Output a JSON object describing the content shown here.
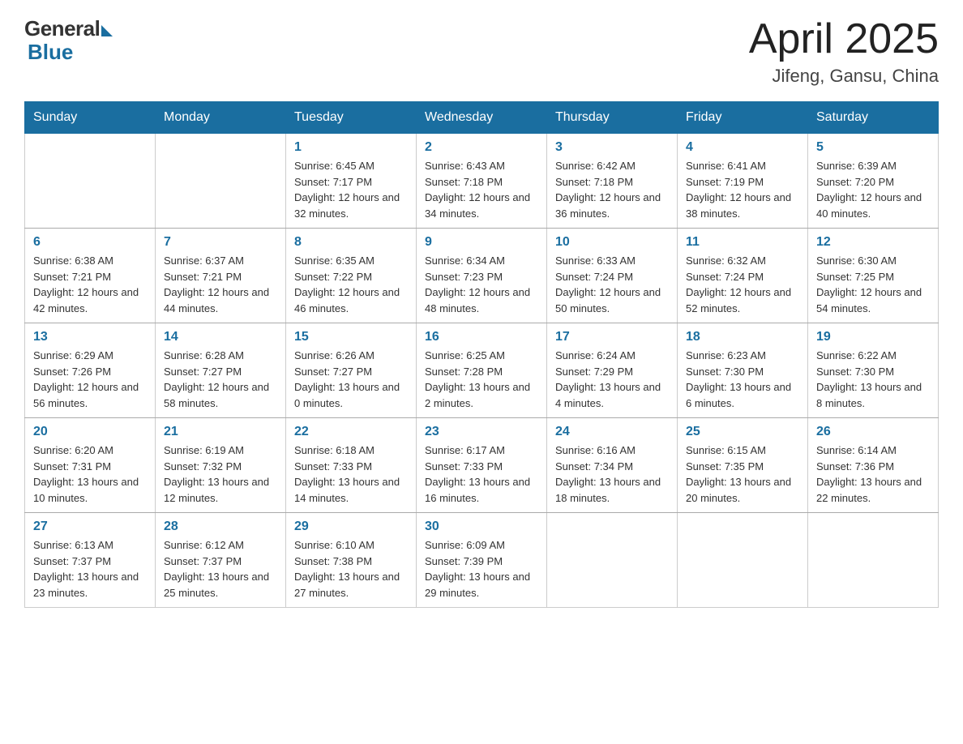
{
  "header": {
    "logo_general": "General",
    "logo_blue": "Blue",
    "title": "April 2025",
    "location": "Jifeng, Gansu, China"
  },
  "weekdays": [
    "Sunday",
    "Monday",
    "Tuesday",
    "Wednesday",
    "Thursday",
    "Friday",
    "Saturday"
  ],
  "weeks": [
    [
      {
        "day": "",
        "sunrise": "",
        "sunset": "",
        "daylight": ""
      },
      {
        "day": "",
        "sunrise": "",
        "sunset": "",
        "daylight": ""
      },
      {
        "day": "1",
        "sunrise": "Sunrise: 6:45 AM",
        "sunset": "Sunset: 7:17 PM",
        "daylight": "Daylight: 12 hours and 32 minutes."
      },
      {
        "day": "2",
        "sunrise": "Sunrise: 6:43 AM",
        "sunset": "Sunset: 7:18 PM",
        "daylight": "Daylight: 12 hours and 34 minutes."
      },
      {
        "day": "3",
        "sunrise": "Sunrise: 6:42 AM",
        "sunset": "Sunset: 7:18 PM",
        "daylight": "Daylight: 12 hours and 36 minutes."
      },
      {
        "day": "4",
        "sunrise": "Sunrise: 6:41 AM",
        "sunset": "Sunset: 7:19 PM",
        "daylight": "Daylight: 12 hours and 38 minutes."
      },
      {
        "day": "5",
        "sunrise": "Sunrise: 6:39 AM",
        "sunset": "Sunset: 7:20 PM",
        "daylight": "Daylight: 12 hours and 40 minutes."
      }
    ],
    [
      {
        "day": "6",
        "sunrise": "Sunrise: 6:38 AM",
        "sunset": "Sunset: 7:21 PM",
        "daylight": "Daylight: 12 hours and 42 minutes."
      },
      {
        "day": "7",
        "sunrise": "Sunrise: 6:37 AM",
        "sunset": "Sunset: 7:21 PM",
        "daylight": "Daylight: 12 hours and 44 minutes."
      },
      {
        "day": "8",
        "sunrise": "Sunrise: 6:35 AM",
        "sunset": "Sunset: 7:22 PM",
        "daylight": "Daylight: 12 hours and 46 minutes."
      },
      {
        "day": "9",
        "sunrise": "Sunrise: 6:34 AM",
        "sunset": "Sunset: 7:23 PM",
        "daylight": "Daylight: 12 hours and 48 minutes."
      },
      {
        "day": "10",
        "sunrise": "Sunrise: 6:33 AM",
        "sunset": "Sunset: 7:24 PM",
        "daylight": "Daylight: 12 hours and 50 minutes."
      },
      {
        "day": "11",
        "sunrise": "Sunrise: 6:32 AM",
        "sunset": "Sunset: 7:24 PM",
        "daylight": "Daylight: 12 hours and 52 minutes."
      },
      {
        "day": "12",
        "sunrise": "Sunrise: 6:30 AM",
        "sunset": "Sunset: 7:25 PM",
        "daylight": "Daylight: 12 hours and 54 minutes."
      }
    ],
    [
      {
        "day": "13",
        "sunrise": "Sunrise: 6:29 AM",
        "sunset": "Sunset: 7:26 PM",
        "daylight": "Daylight: 12 hours and 56 minutes."
      },
      {
        "day": "14",
        "sunrise": "Sunrise: 6:28 AM",
        "sunset": "Sunset: 7:27 PM",
        "daylight": "Daylight: 12 hours and 58 minutes."
      },
      {
        "day": "15",
        "sunrise": "Sunrise: 6:26 AM",
        "sunset": "Sunset: 7:27 PM",
        "daylight": "Daylight: 13 hours and 0 minutes."
      },
      {
        "day": "16",
        "sunrise": "Sunrise: 6:25 AM",
        "sunset": "Sunset: 7:28 PM",
        "daylight": "Daylight: 13 hours and 2 minutes."
      },
      {
        "day": "17",
        "sunrise": "Sunrise: 6:24 AM",
        "sunset": "Sunset: 7:29 PM",
        "daylight": "Daylight: 13 hours and 4 minutes."
      },
      {
        "day": "18",
        "sunrise": "Sunrise: 6:23 AM",
        "sunset": "Sunset: 7:30 PM",
        "daylight": "Daylight: 13 hours and 6 minutes."
      },
      {
        "day": "19",
        "sunrise": "Sunrise: 6:22 AM",
        "sunset": "Sunset: 7:30 PM",
        "daylight": "Daylight: 13 hours and 8 minutes."
      }
    ],
    [
      {
        "day": "20",
        "sunrise": "Sunrise: 6:20 AM",
        "sunset": "Sunset: 7:31 PM",
        "daylight": "Daylight: 13 hours and 10 minutes."
      },
      {
        "day": "21",
        "sunrise": "Sunrise: 6:19 AM",
        "sunset": "Sunset: 7:32 PM",
        "daylight": "Daylight: 13 hours and 12 minutes."
      },
      {
        "day": "22",
        "sunrise": "Sunrise: 6:18 AM",
        "sunset": "Sunset: 7:33 PM",
        "daylight": "Daylight: 13 hours and 14 minutes."
      },
      {
        "day": "23",
        "sunrise": "Sunrise: 6:17 AM",
        "sunset": "Sunset: 7:33 PM",
        "daylight": "Daylight: 13 hours and 16 minutes."
      },
      {
        "day": "24",
        "sunrise": "Sunrise: 6:16 AM",
        "sunset": "Sunset: 7:34 PM",
        "daylight": "Daylight: 13 hours and 18 minutes."
      },
      {
        "day": "25",
        "sunrise": "Sunrise: 6:15 AM",
        "sunset": "Sunset: 7:35 PM",
        "daylight": "Daylight: 13 hours and 20 minutes."
      },
      {
        "day": "26",
        "sunrise": "Sunrise: 6:14 AM",
        "sunset": "Sunset: 7:36 PM",
        "daylight": "Daylight: 13 hours and 22 minutes."
      }
    ],
    [
      {
        "day": "27",
        "sunrise": "Sunrise: 6:13 AM",
        "sunset": "Sunset: 7:37 PM",
        "daylight": "Daylight: 13 hours and 23 minutes."
      },
      {
        "day": "28",
        "sunrise": "Sunrise: 6:12 AM",
        "sunset": "Sunset: 7:37 PM",
        "daylight": "Daylight: 13 hours and 25 minutes."
      },
      {
        "day": "29",
        "sunrise": "Sunrise: 6:10 AM",
        "sunset": "Sunset: 7:38 PM",
        "daylight": "Daylight: 13 hours and 27 minutes."
      },
      {
        "day": "30",
        "sunrise": "Sunrise: 6:09 AM",
        "sunset": "Sunset: 7:39 PM",
        "daylight": "Daylight: 13 hours and 29 minutes."
      },
      {
        "day": "",
        "sunrise": "",
        "sunset": "",
        "daylight": ""
      },
      {
        "day": "",
        "sunrise": "",
        "sunset": "",
        "daylight": ""
      },
      {
        "day": "",
        "sunrise": "",
        "sunset": "",
        "daylight": ""
      }
    ]
  ]
}
